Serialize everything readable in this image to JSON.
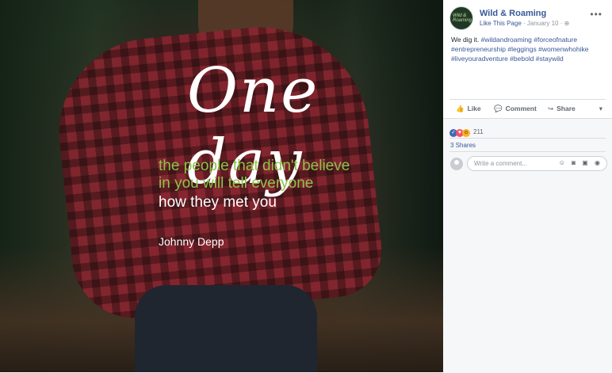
{
  "post_image": {
    "quote_script": "One day",
    "quote_line1": "the people that didn't believe",
    "quote_line2": "in you will tell everyone",
    "quote_line3": "how they met you",
    "author": "Johnny Depp",
    "colors": {
      "green": "#8bc34a",
      "white": "#ffffff"
    }
  },
  "header": {
    "avatar_text": "Wild & Roaming",
    "page_name": "Wild & Roaming",
    "like_link": "Like This Page",
    "date": "· January 10 ·",
    "privacy_icon": "globe-icon",
    "more": "•••"
  },
  "post": {
    "text": "We dig it. ",
    "hashtags": "#wildandroaming #forceofnature #entrepreneurship #leggings #womenwhohike #liveyouradventure #bebold #staywild"
  },
  "actions": {
    "like_label": "Like",
    "comment_label": "Comment",
    "share_label": "Share",
    "like_icon": "👍",
    "comment_icon": "💬",
    "share_icon": "↪",
    "more": "▾"
  },
  "feedback": {
    "reaction_count": "211",
    "shares": "3 Shares",
    "comment_placeholder": "Write a comment...",
    "comment_icons": "☺ ◙ ▣ ◉"
  }
}
